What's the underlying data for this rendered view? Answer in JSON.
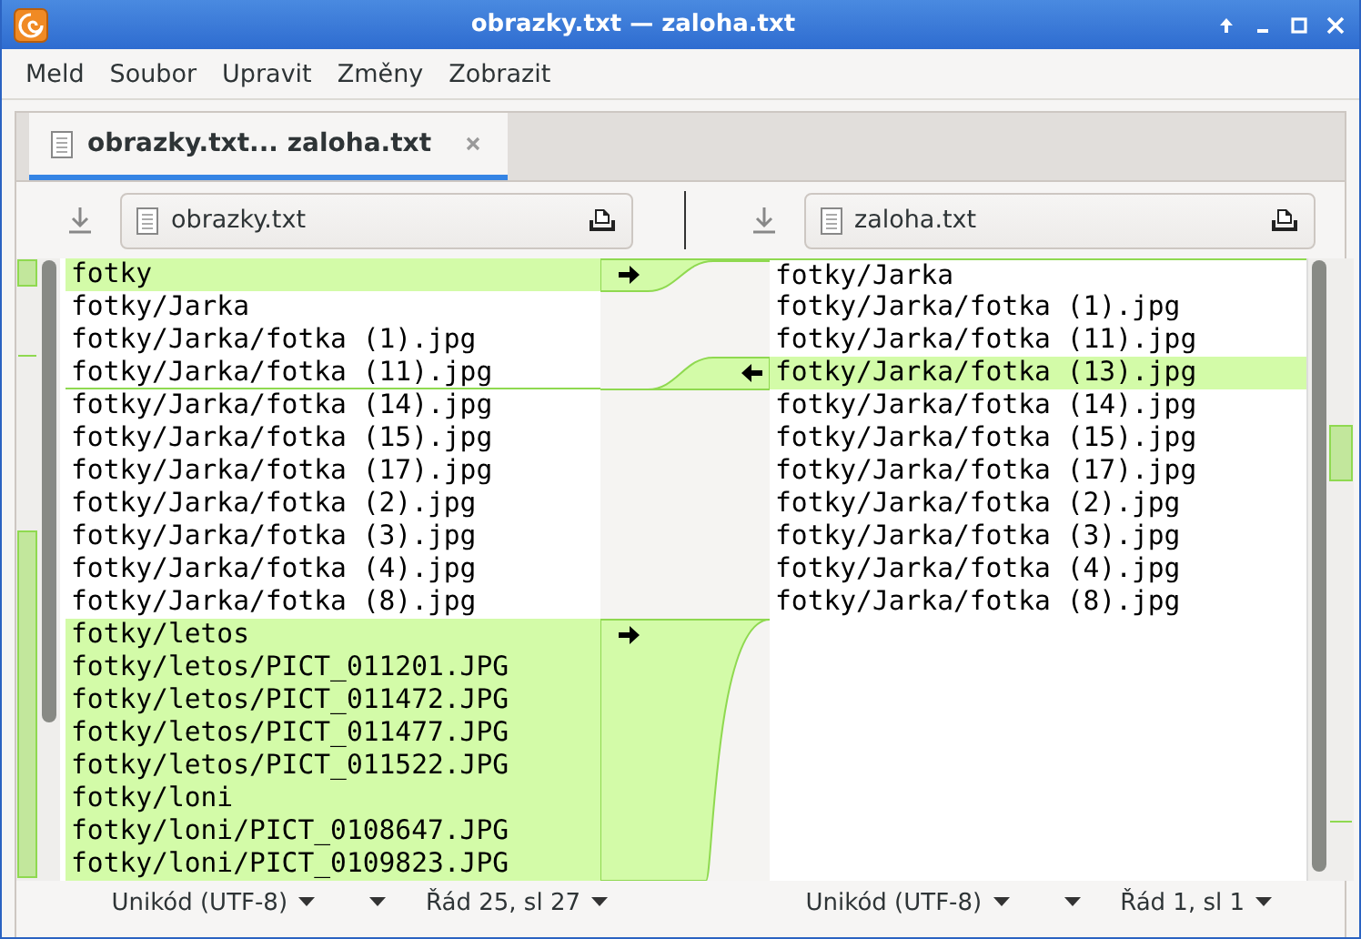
{
  "window": {
    "title": "obrazky.txt — zaloha.txt"
  },
  "menu": [
    "Meld",
    "Soubor",
    "Upravit",
    "Změny",
    "Zobrazit"
  ],
  "tabs": [
    {
      "label": "obrazky.txt... zaloha.txt",
      "selected": true
    }
  ],
  "left_pane": {
    "file": "obrazky.txt",
    "lines": [
      {
        "text": "fotky",
        "changed": true,
        "arrow": true
      },
      {
        "text": "fotky/Jarka",
        "changed": false,
        "arrow": false
      },
      {
        "text": "fotky/Jarka/fotka (1).jpg",
        "changed": false,
        "arrow": false
      },
      {
        "text": "fotky/Jarka/fotka (11).jpg",
        "changed": false,
        "arrow": false,
        "marker_below": true
      },
      {
        "text": "fotky/Jarka/fotka (14).jpg",
        "changed": false,
        "arrow": false
      },
      {
        "text": "fotky/Jarka/fotka (15).jpg",
        "changed": false,
        "arrow": false
      },
      {
        "text": "fotky/Jarka/fotka (17).jpg",
        "changed": false,
        "arrow": false
      },
      {
        "text": "fotky/Jarka/fotka (2).jpg",
        "changed": false,
        "arrow": false
      },
      {
        "text": "fotky/Jarka/fotka (3).jpg",
        "changed": false,
        "arrow": false
      },
      {
        "text": "fotky/Jarka/fotka (4).jpg",
        "changed": false,
        "arrow": false
      },
      {
        "text": "fotky/Jarka/fotka (8).jpg",
        "changed": false,
        "arrow": false
      },
      {
        "text": "fotky/letos",
        "changed": true,
        "arrow": true
      },
      {
        "text": "fotky/letos/PICT_011201.JPG",
        "changed": true,
        "arrow": false
      },
      {
        "text": "fotky/letos/PICT_011472.JPG",
        "changed": true,
        "arrow": false
      },
      {
        "text": "fotky/letos/PICT_011477.JPG",
        "changed": true,
        "arrow": false
      },
      {
        "text": "fotky/letos/PICT_011522.JPG",
        "changed": true,
        "arrow": false
      },
      {
        "text": "fotky/loni",
        "changed": true,
        "arrow": false
      },
      {
        "text": "fotky/loni/PICT_0108647.JPG",
        "changed": true,
        "arrow": false
      },
      {
        "text": "fotky/loni/PICT_0109823.JPG",
        "changed": true,
        "arrow": false
      }
    ],
    "status": {
      "encoding": "Unikód (UTF-8)",
      "position": "Řád 25, sl 27"
    }
  },
  "right_pane": {
    "file": "zaloha.txt",
    "lines": [
      {
        "text": "fotky/Jarka",
        "changed": false,
        "arrow": false,
        "marker_above": true
      },
      {
        "text": "fotky/Jarka/fotka (1).jpg",
        "changed": false,
        "arrow": false
      },
      {
        "text": "fotky/Jarka/fotka (11).jpg",
        "changed": false,
        "arrow": false
      },
      {
        "text": "fotky/Jarka/fotka (13).jpg",
        "changed": true,
        "arrow": true
      },
      {
        "text": "fotky/Jarka/fotka (14).jpg",
        "changed": false,
        "arrow": false
      },
      {
        "text": "fotky/Jarka/fotka (15).jpg",
        "changed": false,
        "arrow": false
      },
      {
        "text": "fotky/Jarka/fotka (17).jpg",
        "changed": false,
        "arrow": false
      },
      {
        "text": "fotky/Jarka/fotka (2).jpg",
        "changed": false,
        "arrow": false
      },
      {
        "text": "fotky/Jarka/fotka (3).jpg",
        "changed": false,
        "arrow": false
      },
      {
        "text": "fotky/Jarka/fotka (4).jpg",
        "changed": false,
        "arrow": false
      },
      {
        "text": "fotky/Jarka/fotka (8).jpg",
        "changed": false,
        "arrow": false
      }
    ],
    "status": {
      "encoding": "Unikód (UTF-8)",
      "position": "Řád 1, sl 1"
    }
  }
}
